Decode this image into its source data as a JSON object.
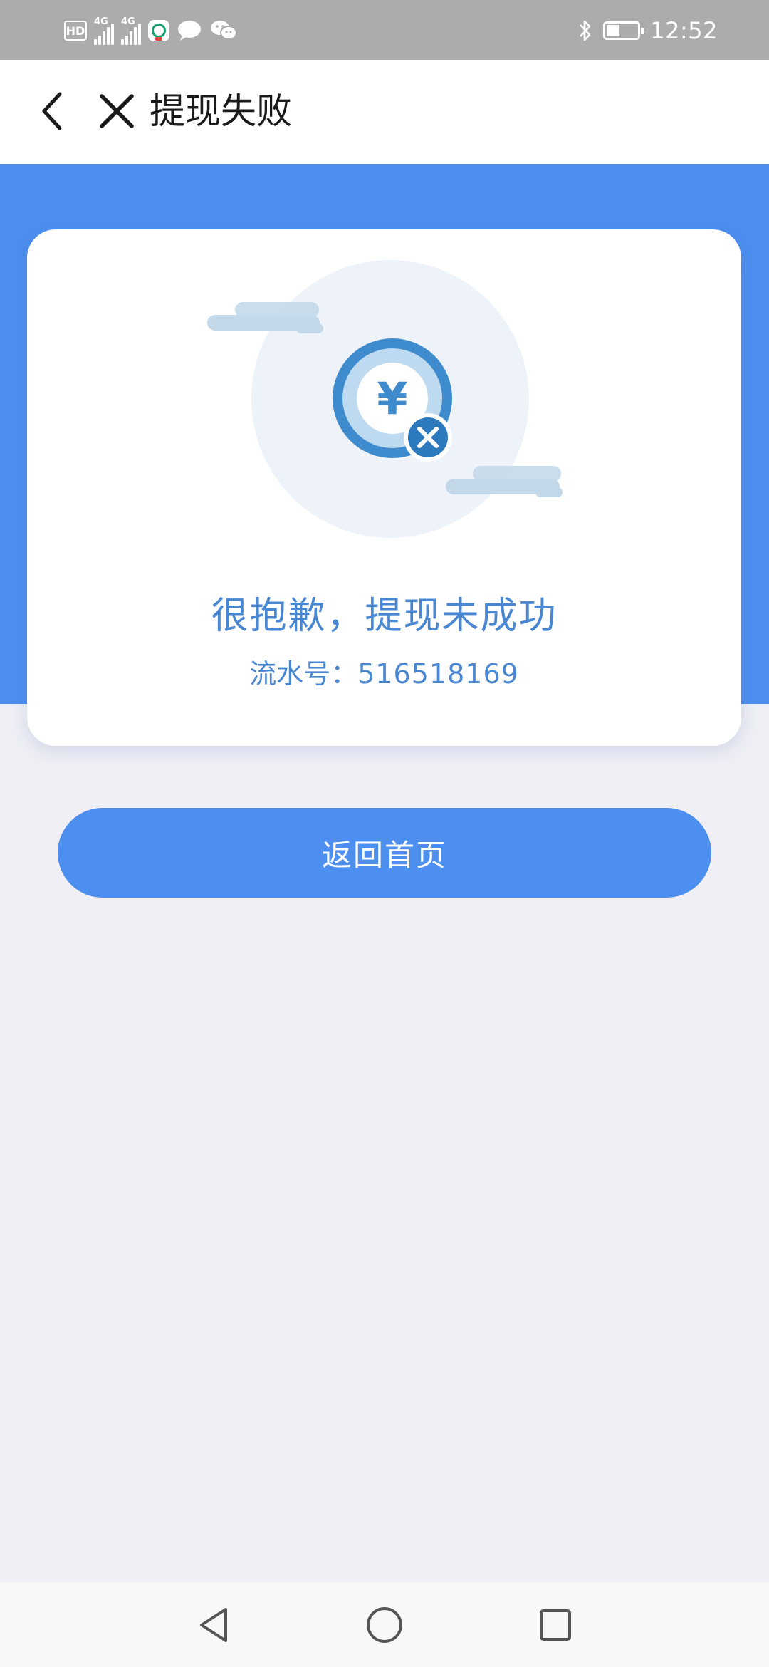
{
  "status_bar": {
    "hd_label": "HD",
    "network_1": "4G",
    "network_2": "4G",
    "time": "12:52",
    "icons": [
      "hd-icon",
      "signal-icon",
      "signal-icon",
      "app-notification-icon",
      "message-icon",
      "wechat-icon",
      "bluetooth-icon",
      "battery-icon"
    ]
  },
  "nav": {
    "title": "提现失败",
    "back_icon": "chevron-left-icon",
    "close_icon": "close-icon"
  },
  "result": {
    "title": "很抱歉，提现未成功",
    "serial_label": "流水号：",
    "serial_number": "516518169",
    "icon": "yuan-coin-failed-icon"
  },
  "actions": {
    "home_button": "返回首页"
  },
  "system_nav": {
    "icons": [
      "back-triangle-icon",
      "home-circle-icon",
      "recents-square-icon"
    ]
  },
  "colors": {
    "accent_blue": "#4c8fef",
    "text_blue": "#4a87d2",
    "page_bg": "#efeff5",
    "status_bar_bg": "#acacac"
  }
}
